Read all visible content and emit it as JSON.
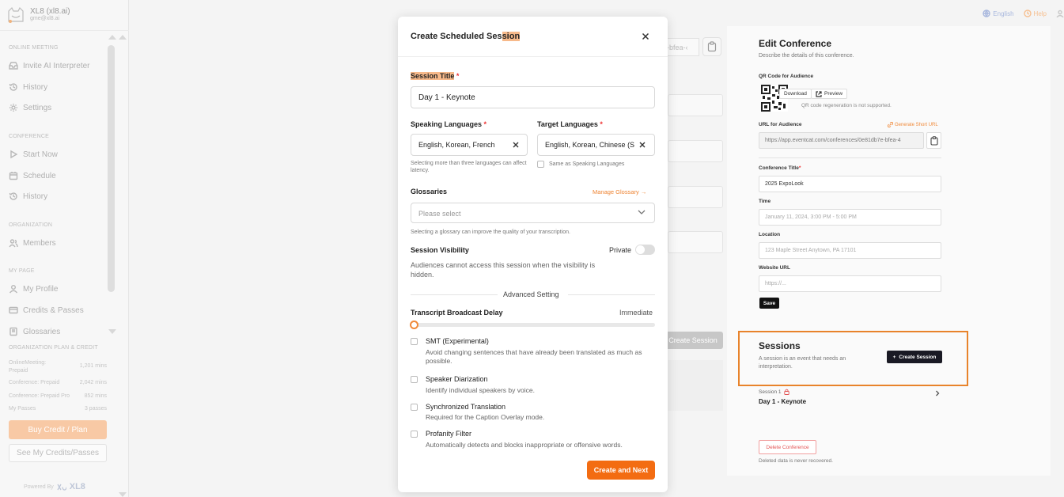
{
  "brand": {
    "name": "XL8 (xl8.ai)",
    "email": "gme@xl8.ai"
  },
  "sidebar": {
    "online_meeting_label": "ONLINE MEETING",
    "online_meeting_items": [
      "Invite AI Interpreter",
      "History",
      "Settings"
    ],
    "conference_label": "CONFERENCE",
    "conference_items": [
      "Start Now",
      "Schedule",
      "History"
    ],
    "organization_label": "ORGANIZATION",
    "organization_items": [
      "Members"
    ],
    "mypage_label": "MY PAGE",
    "mypage_items": [
      "My Profile",
      "Credits & Passes",
      "Glossaries"
    ],
    "plan_label": "ORGANIZATION PLAN & CREDIT",
    "plan_rows": [
      {
        "name": "OnlineMeeting:\nPrepaid",
        "value": "1,201 mins"
      },
      {
        "name": "Conference: Prepaid",
        "value": "2,042 mins"
      },
      {
        "name": "Conference: Prepaid Pro",
        "value": "852 mins"
      },
      {
        "name": "My Passes",
        "value": "3 passes"
      }
    ],
    "buy_button": "Buy Credit / Plan",
    "see_button": "See My Credits/Passes",
    "powered_by": "Powered By",
    "powered_brand": "XL8"
  },
  "topbar": {
    "language": "English",
    "help": "Help"
  },
  "background": {
    "url_fragment": "-bfea-‹",
    "create_session_button": "Create Session"
  },
  "edit_conference": {
    "title": "Edit Conference",
    "description": "Describe the details of this conference.",
    "qr_label": "QR Code for Audience",
    "download_button": "Download",
    "preview_button": "Preview",
    "qr_note": "QR code regeneration is not supported.",
    "url_label": "URL for Audience",
    "generate_short_url": "Generate Short URL",
    "url_value": "https://app.eventcat.com/conferences/0e81db7e-bfea-4",
    "conference_title_label": "Conference Title",
    "conference_title_value": "2025 ExpoLook",
    "time_label": "Time",
    "time_placeholder": "January 11, 2024, 3:00 PM - 5:00 PM",
    "location_label": "Location",
    "location_placeholder": "123 Maple Street Anytown, PA 17101",
    "website_label": "Website URL",
    "website_placeholder": "https://...",
    "save_button": "Save",
    "sessions_title": "Sessions",
    "sessions_desc": "A session is an event that needs an interpretation.",
    "create_session_button": "Create Session",
    "session_item_label": "Session 1",
    "session_item_name": "Day 1 - Keynote",
    "delete_button": "Delete Conference",
    "delete_note": "Deleted data is never recovered."
  },
  "modal": {
    "title_pre": "Create Scheduled Ses",
    "title_hl": "sion",
    "session_title_label": "Session Title",
    "session_title_value": "Day 1 - Keynote",
    "speaking_label": "Speaking Languages",
    "speaking_value": "English, Korean, French",
    "target_label": "Target Languages",
    "target_value": "English, Korean, Chinese (S",
    "speaking_help": "Selecting more than three languages can affect latency.",
    "same_as_label": "Same as Speaking Languages",
    "glossaries_label": "Glossaries",
    "manage_glossary": "Manage Glossary →",
    "glossary_placeholder": "Please select",
    "glossary_help": "Selecting a glossary can improve the quality of your transcription.",
    "visibility_label": "Session Visibility",
    "private_label": "Private",
    "visibility_desc": "Audiences cannot access this session when the visibility is hidden.",
    "advanced_label": "Advanced Setting",
    "delay_label": "Transcript Broadcast Delay",
    "delay_value": "Immediate",
    "delay_level": 0,
    "options": [
      {
        "title": "SMT (Experimental)",
        "desc": "Avoid changing sentences that have already been translated as much as possible."
      },
      {
        "title": "Speaker Diarization",
        "desc": "Identify individual speakers by voice."
      },
      {
        "title": "Synchronized Translation",
        "desc": "Required for the Caption Overlay mode."
      },
      {
        "title": "Profanity Filter",
        "desc": "Automatically detects and blocks inappropriate or offensive words."
      }
    ],
    "cta": "Create and Next"
  },
  "colors": {
    "accent": "#f36c12",
    "highlight": "#f7b98a",
    "sessions_outline": "#e8832b",
    "dark_button": "#1a1a24"
  }
}
